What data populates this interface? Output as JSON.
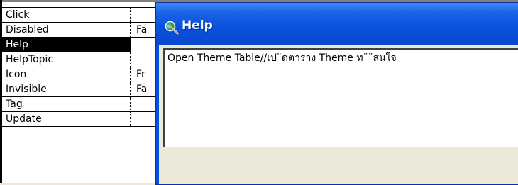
{
  "properties": [
    {
      "name": "Click",
      "value": ""
    },
    {
      "name": "Disabled",
      "value": "Fa"
    },
    {
      "name": "Help",
      "value": "",
      "selected": true
    },
    {
      "name": "HelpTopic",
      "value": ""
    },
    {
      "name": "Icon",
      "value": "Fr"
    },
    {
      "name": "Invisible",
      "value": "Fa"
    },
    {
      "name": "Tag",
      "value": ""
    },
    {
      "name": "Update",
      "value": ""
    }
  ],
  "help_window": {
    "title": "Help",
    "icon": "magnifier-globe-icon",
    "text": "Open Theme Table//เป¨ดตาราง Theme ท¨¨สนใจ"
  },
  "dropdown": {
    "icon": "chevron-down-icon",
    "glyph": "▼"
  },
  "colors": {
    "title_bar": "#0a4ee0",
    "selected_row": "#000000",
    "window_face": "#ece9d8"
  }
}
